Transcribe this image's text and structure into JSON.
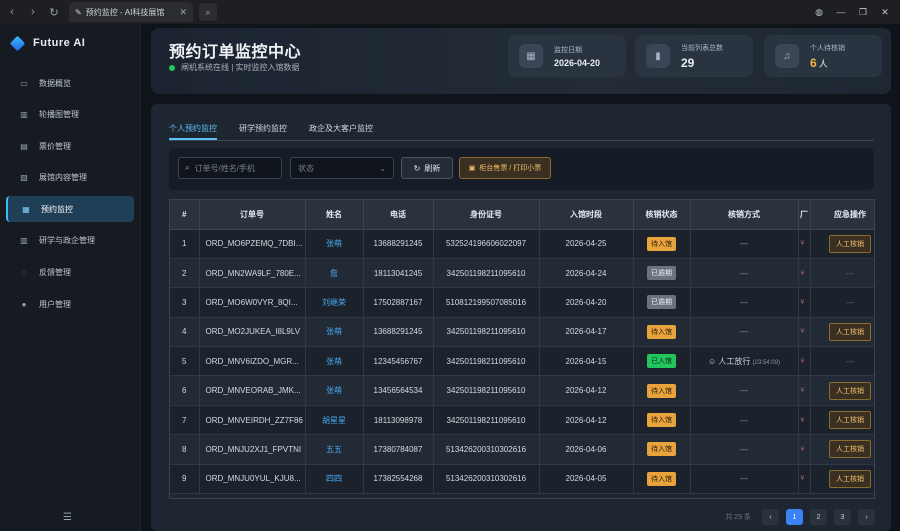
{
  "browser": {
    "tab_title": "预约监控 - AI科技展馆",
    "tab_close": "✕"
  },
  "sidebar": {
    "brand": "Future AI",
    "items": [
      {
        "label": "数据概览",
        "icon": "monitor-icon"
      },
      {
        "label": "轮播图管理",
        "icon": "building-icon"
      },
      {
        "label": "票价管理",
        "icon": "ticket-icon"
      },
      {
        "label": "展馆内容管理",
        "icon": "image-icon"
      },
      {
        "label": "预约监控",
        "icon": "calendar-icon",
        "active": true
      },
      {
        "label": "研学与政企管理",
        "icon": "building-icon"
      },
      {
        "label": "反馈管理",
        "icon": "chat-icon"
      },
      {
        "label": "用户管理",
        "icon": "user-icon"
      }
    ]
  },
  "header": {
    "title": "预约订单监控中心",
    "status": "闸机系统在线 | 实时监控入馆数据",
    "stats": [
      {
        "label": "监控日期",
        "value": "2026-04-20"
      },
      {
        "label": "当前列表总数",
        "value": "29"
      },
      {
        "label": "个人待核销",
        "value": "6",
        "unit": "人"
      }
    ]
  },
  "tabs": [
    "个人预约监控",
    "研学预约监控",
    "政企及大客户监控"
  ],
  "filters": {
    "search_placeholder": "订单号/姓名/手机",
    "status_placeholder": "状态",
    "refresh_label": "刷新",
    "print_label": "柜台售票 / 打印小票"
  },
  "table": {
    "columns": [
      "#",
      "订单号",
      "姓名",
      "电话",
      "身份证号",
      "入馆时段",
      "核销状态",
      "核销方式",
      "厂",
      "应急操作"
    ],
    "rows": [
      {
        "no": "1",
        "order": "ORD_MO6PZEMQ_7DBI...",
        "name": "张萌",
        "phone": "13688291245",
        "id": "532524196606022097",
        "date": "2026-04-25",
        "status": "待入馆",
        "type": "pending",
        "method": "---",
        "yen": "¥",
        "op": "人工核销"
      },
      {
        "no": "2",
        "order": "ORD_MN2WA9LF_780E...",
        "name": "詹",
        "phone": "18113041245",
        "id": "342501198211095610",
        "date": "2026-04-24",
        "status": "已逾期",
        "type": "done",
        "method": "---",
        "yen": "¥",
        "op": "---"
      },
      {
        "no": "3",
        "order": "ORD_MO6W0VYR_8QI...",
        "name": "刘继荣",
        "phone": "17502887167",
        "id": "510812199507085016",
        "date": "2026-04-20",
        "status": "已逾期",
        "type": "done",
        "method": "---",
        "yen": "¥",
        "op": "---"
      },
      {
        "no": "4",
        "order": "ORD_MO2JUKEA_I8L9LV",
        "name": "张萌",
        "phone": "13688291245",
        "id": "342501198211095610",
        "date": "2026-04-17",
        "status": "待入馆",
        "type": "pending",
        "method": "---",
        "yen": "¥",
        "op": "人工核销"
      },
      {
        "no": "5",
        "order": "ORD_MNV6IZDO_MGR...",
        "name": "张萌",
        "phone": "12345456767",
        "id": "342501198211095610",
        "date": "2026-04-15",
        "status": "已入馆",
        "type": "entered",
        "method": "人工放行",
        "method_time": "(23:54:09)",
        "yen": "¥",
        "op": "---"
      },
      {
        "no": "6",
        "order": "ORD_MNVEORAB_JMK...",
        "name": "张萌",
        "phone": "13456564534",
        "id": "342501198211095610",
        "date": "2026-04-12",
        "status": "待入馆",
        "type": "pending",
        "method": "---",
        "yen": "¥",
        "op": "人工核销"
      },
      {
        "no": "7",
        "order": "ORD_MNVEIRDH_ZZ7F86",
        "name": "胡星星",
        "phone": "18113098978",
        "id": "342501198211095610",
        "date": "2026-04-12",
        "status": "待入馆",
        "type": "pending",
        "method": "---",
        "yen": "¥",
        "op": "人工核销"
      },
      {
        "no": "8",
        "order": "ORD_MNJU2XJ1_FPVTNI",
        "name": "五五",
        "phone": "17380784087",
        "id": "513426200310302616",
        "date": "2026-04-06",
        "status": "待入馆",
        "type": "pending",
        "method": "---",
        "yen": "¥",
        "op": "人工核销"
      },
      {
        "no": "9",
        "order": "ORD_MNJU0YUL_KJU8...",
        "name": "四四",
        "phone": "17382554268",
        "id": "513426200310302616",
        "date": "2026-04-05",
        "status": "待入馆",
        "type": "pending",
        "method": "---",
        "yen": "¥",
        "op": "人工核销"
      }
    ]
  },
  "pager": {
    "total": "共 29 条",
    "pages": [
      "1",
      "2",
      "3"
    ],
    "prev": "‹",
    "next": "›"
  }
}
